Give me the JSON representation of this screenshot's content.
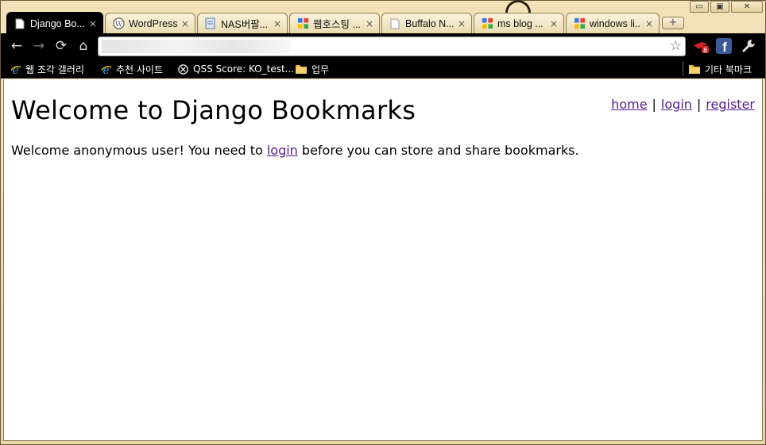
{
  "tabs": [
    {
      "label": "Django Bo...",
      "icon": "page-icon",
      "active": true
    },
    {
      "label": "WordPress...",
      "icon": "wordpress-icon",
      "active": false
    },
    {
      "label": "NAS버팔...",
      "icon": "document-icon",
      "active": false
    },
    {
      "label": "웹호스팅 ...",
      "icon": "google-icon",
      "active": false
    },
    {
      "label": "Buffalo N...",
      "icon": "page-icon",
      "active": false
    },
    {
      "label": "ms blog ...",
      "icon": "google-icon",
      "active": false
    },
    {
      "label": "windows li...",
      "icon": "google-icon",
      "active": false
    }
  ],
  "tab_close_glyph": "×",
  "new_tab_glyph": "+",
  "window": {
    "minimize": "▭",
    "maximize": "▣",
    "close": "✕"
  },
  "toolbar": {
    "back": "←",
    "forward": "→",
    "reload": "⟳",
    "home": "⌂",
    "address_value": "",
    "star": "☆",
    "ext_badge": "8"
  },
  "bookmarks": [
    {
      "label": "웹 조각 갤러리",
      "icon": "ie-icon"
    },
    {
      "label": "추천 사이트",
      "icon": "ie-icon"
    },
    {
      "label": "QSS Score: KO_test...",
      "icon": "qss-icon"
    },
    {
      "label": "업무",
      "icon": "folder-icon"
    }
  ],
  "other_bookmarks": {
    "label": "기타 북마크",
    "icon": "folder-icon"
  },
  "page": {
    "title": "Welcome to Django Bookmarks",
    "nav": {
      "home": "home",
      "login": "login",
      "register": "register",
      "separator": "|"
    },
    "welcome_before": "Welcome anonymous user! You need to ",
    "welcome_link": "login",
    "welcome_after": " before you can store and share bookmarks."
  },
  "colors": {
    "link_visited": "#551a8b",
    "chrome_bg": "#000000",
    "frame": "#ead7a6"
  }
}
